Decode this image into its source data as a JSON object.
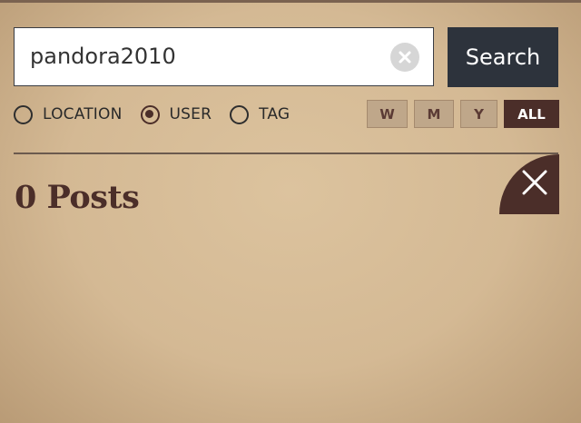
{
  "search": {
    "value": "pandora2010",
    "clear_icon": "clear-icon",
    "button_label": "Search"
  },
  "filters": {
    "types": [
      {
        "label": "LOCATION",
        "selected": false
      },
      {
        "label": "USER",
        "selected": true
      },
      {
        "label": "TAG",
        "selected": false
      }
    ],
    "periods": [
      {
        "label": "W",
        "selected": false
      },
      {
        "label": "M",
        "selected": false
      },
      {
        "label": "Y",
        "selected": false
      },
      {
        "label": "ALL",
        "selected": true
      }
    ]
  },
  "results": {
    "title": "0 Posts",
    "close_icon": "close-icon"
  },
  "colors": {
    "background": "#d4b994",
    "accent": "#4b2e29",
    "button_dark": "#2d333c",
    "period_inactive": "#bfa78a"
  }
}
